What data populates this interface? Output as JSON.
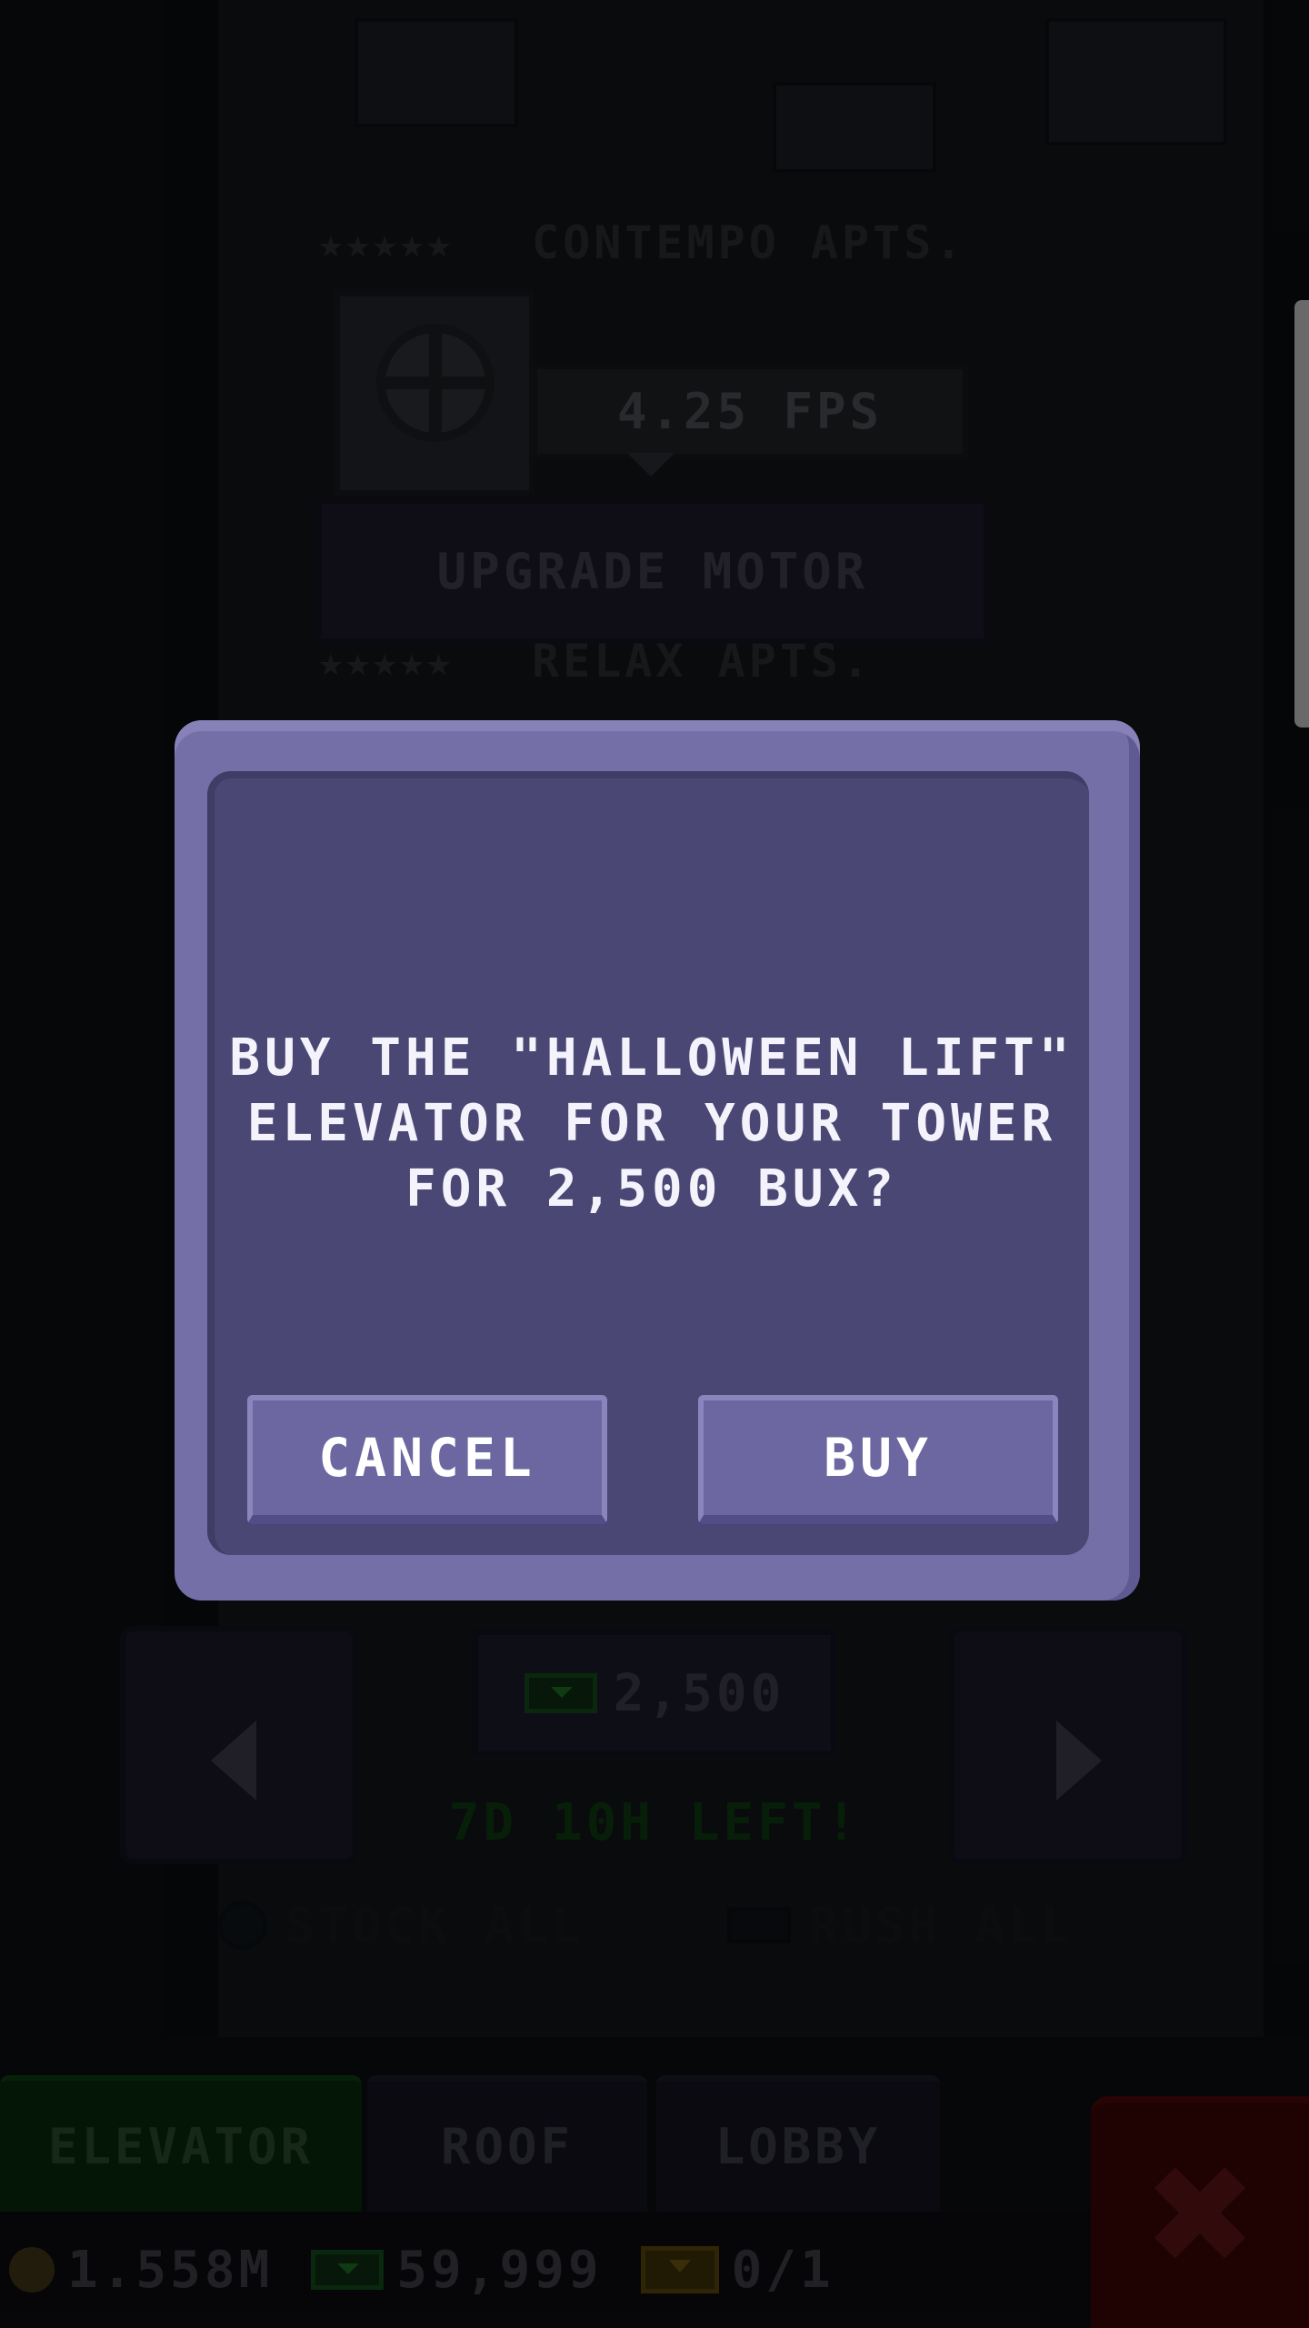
{
  "scene": {
    "floor_top_label": "CONTEMPO APTS.",
    "floor_top_stars": "★★★★★",
    "floor_bottom_label": "RELAX APTS.",
    "floor_bottom_stars": "★★★★★",
    "fps": "4.25 FPS",
    "upgrade_label": "UPGRADE MOTOR",
    "price": "2,500",
    "timer": "7D 10H LEFT!",
    "stock_all": "STOCK ALL",
    "rush_all": "RUSH ALL"
  },
  "tabs": [
    {
      "label": "ELEVATOR",
      "active": true
    },
    {
      "label": "ROOF",
      "active": false
    },
    {
      "label": "LOBBY",
      "active": false
    }
  ],
  "status": {
    "coins": "1.558M",
    "bux": "59,999",
    "tickets": "0/1"
  },
  "dialog": {
    "message": "BUY THE \"HALLOWEEN LIFT\"\nELEVATOR FOR YOUR TOWER\nFOR 2,500 BUX?",
    "cancel_label": "CANCEL",
    "buy_label": "BUY"
  },
  "icons": {
    "close": "close-x-icon",
    "coin": "coin-icon",
    "bux": "bux-icon",
    "ticket": "ticket-icon"
  },
  "colors": {
    "dialog_frame": "#756fa8",
    "dialog_inner": "#4a4775",
    "button": "#6c67a0",
    "active_tab": "#082a0c",
    "close_button": "#3a0606"
  }
}
